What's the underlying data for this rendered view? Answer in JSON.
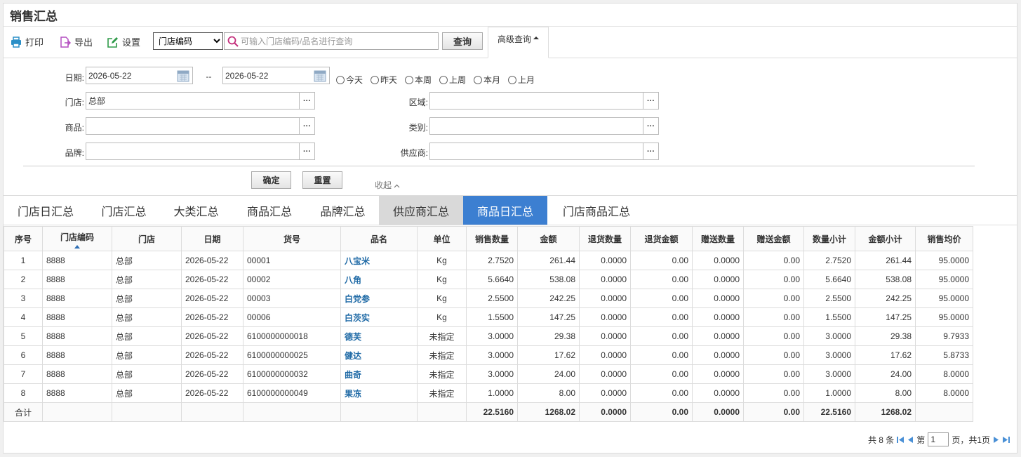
{
  "title": "销售汇总",
  "toolbar": {
    "print_label": "打印",
    "export_label": "导出",
    "settings_label": "设置",
    "select_value": "门店编码",
    "search_placeholder": "可输入门店编码/品名进行查询",
    "query_label": "查询",
    "advanced_label": "高级查询"
  },
  "filters": {
    "date_label": "日期:",
    "date_from": "2026-05-22",
    "date_sep": "--",
    "date_to": "2026-05-22",
    "quick_ranges": [
      "今天",
      "昨天",
      "本周",
      "上周",
      "本月",
      "上月"
    ],
    "store_label": "门店:",
    "store_value": "总部",
    "region_label": "区域:",
    "region_value": "",
    "product_label": "商品:",
    "product_value": "",
    "category_label": "类别:",
    "category_value": "",
    "brand_label": "品牌:",
    "brand_value": "",
    "supplier_label": "供应商:",
    "supplier_value": "",
    "dots": "···",
    "confirm_label": "确定",
    "reset_label": "重置",
    "collapse_label": "收起"
  },
  "tabs": [
    "门店日汇总",
    "门店汇总",
    "大类汇总",
    "商品汇总",
    "品牌汇总",
    "供应商汇总",
    "商品日汇总",
    "门店商品汇总"
  ],
  "active_tab": "商品日汇总",
  "table": {
    "headers": [
      "序号",
      "门店编码",
      "门店",
      "日期",
      "货号",
      "品名",
      "单位",
      "销售数量",
      "金额",
      "退货数量",
      "退货金额",
      "赠送数量",
      "赠送金额",
      "数量小计",
      "金额小计",
      "销售均价"
    ],
    "rows": [
      [
        "1",
        "8888",
        "总部",
        "2026-05-22",
        "00001",
        "八宝米",
        "Kg",
        "2.7520",
        "261.44",
        "0.0000",
        "0.00",
        "0.0000",
        "0.00",
        "2.7520",
        "261.44",
        "95.0000"
      ],
      [
        "2",
        "8888",
        "总部",
        "2026-05-22",
        "00002",
        "八角",
        "Kg",
        "5.6640",
        "538.08",
        "0.0000",
        "0.00",
        "0.0000",
        "0.00",
        "5.6640",
        "538.08",
        "95.0000"
      ],
      [
        "3",
        "8888",
        "总部",
        "2026-05-22",
        "00003",
        "白党参",
        "Kg",
        "2.5500",
        "242.25",
        "0.0000",
        "0.00",
        "0.0000",
        "0.00",
        "2.5500",
        "242.25",
        "95.0000"
      ],
      [
        "4",
        "8888",
        "总部",
        "2026-05-22",
        "00006",
        "白茨实",
        "Kg",
        "1.5500",
        "147.25",
        "0.0000",
        "0.00",
        "0.0000",
        "0.00",
        "1.5500",
        "147.25",
        "95.0000"
      ],
      [
        "5",
        "8888",
        "总部",
        "2026-05-22",
        "6100000000018",
        "德芙",
        "未指定",
        "3.0000",
        "29.38",
        "0.0000",
        "0.00",
        "0.0000",
        "0.00",
        "3.0000",
        "29.38",
        "9.7933"
      ],
      [
        "6",
        "8888",
        "总部",
        "2026-05-22",
        "6100000000025",
        "健达",
        "未指定",
        "3.0000",
        "17.62",
        "0.0000",
        "0.00",
        "0.0000",
        "0.00",
        "3.0000",
        "17.62",
        "5.8733"
      ],
      [
        "7",
        "8888",
        "总部",
        "2026-05-22",
        "6100000000032",
        "曲奇",
        "未指定",
        "3.0000",
        "24.00",
        "0.0000",
        "0.00",
        "0.0000",
        "0.00",
        "3.0000",
        "24.00",
        "8.0000"
      ],
      [
        "8",
        "8888",
        "总部",
        "2026-05-22",
        "6100000000049",
        "果冻",
        "未指定",
        "1.0000",
        "8.00",
        "0.0000",
        "0.00",
        "0.0000",
        "0.00",
        "1.0000",
        "8.00",
        "8.0000"
      ]
    ],
    "total": [
      "合计",
      "",
      "",
      "",
      "",
      "",
      "",
      "22.5160",
      "1268.02",
      "0.0000",
      "0.00",
      "0.0000",
      "0.00",
      "22.5160",
      "1268.02",
      ""
    ]
  },
  "pager": {
    "total_text": "共 8 条",
    "page_prefix": "第",
    "page_value": "1",
    "page_suffix": "页，共1页"
  },
  "colors": {
    "active_tab": "#3c7fd1",
    "grey_tab": "#d9d9d9",
    "product_name": "#1f6aa6",
    "print_icon": "#2b8fc7",
    "export_icon": "#b44fc0",
    "settings_icon": "#2e9a48",
    "search_icon": "#c4307c"
  }
}
